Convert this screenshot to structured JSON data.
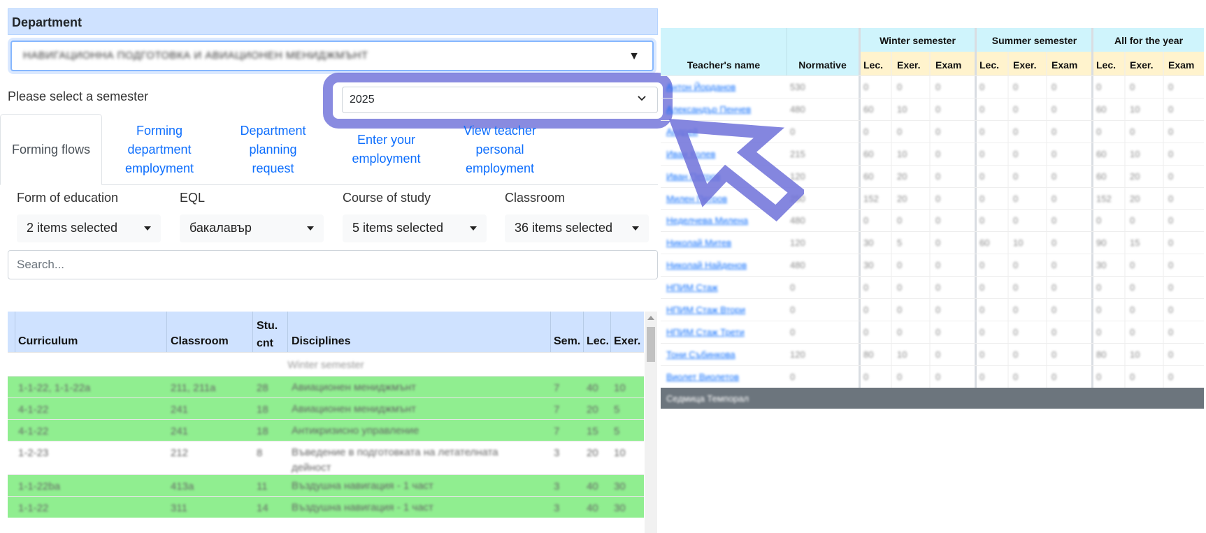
{
  "department": {
    "header": "Department",
    "selected": "НАВИГАЦИОННА ПОДГОТОВКА И АВИАЦИОНЕН МЕНИДЖМЪНТ"
  },
  "semester": {
    "label": "Please select a semester",
    "selected": "2025"
  },
  "tabs": [
    {
      "label": "Forming flows",
      "active": true
    },
    {
      "label": "Forming department employment"
    },
    {
      "label": "Department planning request"
    },
    {
      "label": "Enter your employment"
    },
    {
      "label": "View teacher personal employment"
    }
  ],
  "filters": [
    {
      "label": "Form of education",
      "value": "2 items selected"
    },
    {
      "label": "EQL",
      "value": "бакалавър"
    },
    {
      "label": "Course of study",
      "value": "5 items selected"
    },
    {
      "label": "Classroom",
      "value": "36 items selected"
    }
  ],
  "search": {
    "placeholder": "Search..."
  },
  "curriculum_table": {
    "columns": [
      "Curriculum",
      "Classroom",
      "Stu. cnt",
      "Disciplines",
      "Sem.",
      "Lec.",
      "Exer."
    ],
    "group_label": "Winter semester",
    "rows": [
      {
        "curriculum": "1-1-22, 1-1-22a",
        "classroom": "211, 211a",
        "stu": "28",
        "discipline": "Авиационен мениджмънт",
        "sem": "7",
        "lec": "40",
        "exer": "10",
        "green": true
      },
      {
        "curriculum": "4-1-22",
        "classroom": "241",
        "stu": "18",
        "discipline": "Авиационен мениджмънт",
        "sem": "7",
        "lec": "20",
        "exer": "5",
        "green": true
      },
      {
        "curriculum": "4-1-22",
        "classroom": "241",
        "stu": "18",
        "discipline": "Антикризисно управление",
        "sem": "7",
        "lec": "15",
        "exer": "5",
        "green": true
      },
      {
        "curriculum": "1-2-23",
        "classroom": "212",
        "stu": "8",
        "discipline": "Въведение в подготовката на летателната дейност",
        "sem": "3",
        "lec": "20",
        "exer": "10",
        "green": false
      },
      {
        "curriculum": "1-1-22ba",
        "classroom": "413a",
        "stu": "11",
        "discipline": "Въздушна навигация - 1 част",
        "sem": "3",
        "lec": "40",
        "exer": "30",
        "green": true
      },
      {
        "curriculum": "1-1-22",
        "classroom": "311",
        "stu": "14",
        "discipline": "Въздушна навигация - 1 част",
        "sem": "3",
        "lec": "40",
        "exer": "30",
        "green": true
      }
    ]
  },
  "teachers_table": {
    "col_name": "Teacher's name",
    "col_normative": "Normative",
    "groups": [
      "Winter semester",
      "Summer semester",
      "All for the year"
    ],
    "sub": [
      "Lec.",
      "Exer.",
      "Exam"
    ],
    "rows": [
      {
        "name": "Антон Йорданов",
        "norm": "530",
        "vals": [
          "0",
          "0",
          "0",
          "0",
          "0",
          "0",
          "0",
          "0",
          "0"
        ]
      },
      {
        "name": "Александър Пенчев",
        "norm": "480",
        "vals": [
          "60",
          "10",
          "0",
          "0",
          "0",
          "0",
          "60",
          "10",
          "0"
        ]
      },
      {
        "name": "Андрей",
        "norm": "0",
        "vals": [
          "0",
          "0",
          "0",
          "0",
          "0",
          "0",
          "0",
          "0",
          "0"
        ]
      },
      {
        "name": "Иван Колев",
        "norm": "215",
        "vals": [
          "60",
          "10",
          "0",
          "0",
          "0",
          "0",
          "60",
          "10",
          "0"
        ]
      },
      {
        "name": "Иван Петров",
        "norm": "120",
        "vals": [
          "60",
          "20",
          "0",
          "0",
          "0",
          "0",
          "60",
          "20",
          "0"
        ]
      },
      {
        "name": "Милен Петров",
        "norm": "250",
        "vals": [
          "152",
          "20",
          "0",
          "0",
          "0",
          "0",
          "152",
          "20",
          "0"
        ]
      },
      {
        "name": "Неделчева Милена",
        "norm": "480",
        "vals": [
          "0",
          "0",
          "0",
          "0",
          "0",
          "0",
          "0",
          "0",
          "0"
        ]
      },
      {
        "name": "Николай Митев",
        "norm": "120",
        "vals": [
          "30",
          "5",
          "0",
          "60",
          "10",
          "0",
          "90",
          "15",
          "0"
        ]
      },
      {
        "name": "Николай Найденов",
        "norm": "480",
        "vals": [
          "30",
          "0",
          "0",
          "0",
          "0",
          "0",
          "30",
          "0",
          "0"
        ]
      },
      {
        "name": "НПИМ Стаж",
        "norm": "0",
        "vals": [
          "0",
          "0",
          "0",
          "0",
          "0",
          "0",
          "0",
          "0",
          "0"
        ]
      },
      {
        "name": "НПИМ Стаж Втори",
        "norm": "0",
        "vals": [
          "0",
          "0",
          "0",
          "0",
          "0",
          "0",
          "0",
          "0",
          "0"
        ]
      },
      {
        "name": "НПИМ Стаж Трети",
        "norm": "0",
        "vals": [
          "0",
          "0",
          "0",
          "0",
          "0",
          "0",
          "0",
          "0",
          "0"
        ]
      },
      {
        "name": "Тони Събинкова",
        "norm": "120",
        "vals": [
          "80",
          "10",
          "0",
          "0",
          "0",
          "0",
          "80",
          "10",
          "0"
        ]
      },
      {
        "name": "Виолет Виолетов",
        "norm": "0",
        "vals": [
          "0",
          "0",
          "0",
          "0",
          "0",
          "0",
          "0",
          "0",
          "0"
        ]
      }
    ],
    "total_label": "Седмица Темпорал"
  },
  "colors": {
    "highlight": "#6f71d9",
    "header_blue": "#cfe2ff",
    "green_row": "#90ee90",
    "teacher_head": "#cff4fc",
    "sub_head": "#fff3cd"
  }
}
